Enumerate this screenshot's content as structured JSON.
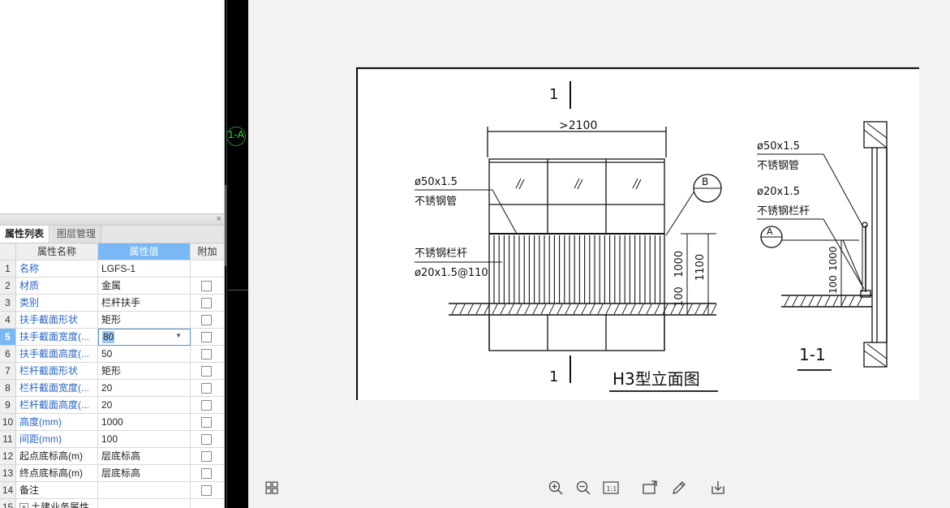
{
  "panel": {
    "close_glyph": "×",
    "tabs": [
      "属性列表",
      "图层管理"
    ],
    "columns": [
      "属性名称",
      "属性值",
      "附加"
    ],
    "rows": [
      {
        "num": "1",
        "name": "名称",
        "value": "LGFS-1",
        "blue": true,
        "checkbox": false
      },
      {
        "num": "2",
        "name": "材质",
        "value": "金属",
        "blue": true,
        "checkbox": true
      },
      {
        "num": "3",
        "name": "类别",
        "value": "栏杆扶手",
        "blue": true,
        "checkbox": true
      },
      {
        "num": "4",
        "name": "扶手截面形状",
        "value": "矩形",
        "blue": true,
        "checkbox": true
      },
      {
        "num": "5",
        "name": "扶手截面宽度(...",
        "value": "80",
        "blue": true,
        "checkbox": true,
        "editing": true
      },
      {
        "num": "6",
        "name": "扶手截面高度(...",
        "value": "50",
        "blue": true,
        "checkbox": true
      },
      {
        "num": "7",
        "name": "栏杆截面形状",
        "value": "矩形",
        "blue": true,
        "checkbox": true
      },
      {
        "num": "8",
        "name": "栏杆截面宽度(...",
        "value": "20",
        "blue": true,
        "checkbox": true
      },
      {
        "num": "9",
        "name": "栏杆截面高度(...",
        "value": "20",
        "blue": true,
        "checkbox": true
      },
      {
        "num": "10",
        "name": "高度(mm)",
        "value": "1000",
        "blue": true,
        "checkbox": true
      },
      {
        "num": "11",
        "name": "间距(mm)",
        "value": "100",
        "blue": true,
        "checkbox": true
      },
      {
        "num": "12",
        "name": "起点底标高(m)",
        "value": "层底标高",
        "blue": false,
        "checkbox": true
      },
      {
        "num": "13",
        "name": "终点底标高(m)",
        "value": "层底标高",
        "blue": false,
        "checkbox": true
      },
      {
        "num": "14",
        "name": "备注",
        "value": "",
        "blue": false,
        "checkbox": true
      },
      {
        "num": "15",
        "name": "土建业务属性",
        "value": "",
        "blue": false,
        "checkbox": false,
        "expander": "+"
      }
    ]
  },
  "cad": {
    "label": "1-A"
  },
  "drawing": {
    "section_mark": "1",
    "dim_width": ">2100",
    "handrail_spec": "ø50x1.5",
    "handrail_name": "不锈钢管",
    "baluster_name": "不锈钢栏杆",
    "baluster_spec": "ø20x1.5@110",
    "dim_1000": "1000",
    "dim_1100": "1100",
    "dim_100": "100",
    "callout_b": "B",
    "callout_a": "A",
    "title": "H3型立面图",
    "section_title": "1-1",
    "right_handrail_spec": "ø50x1.5",
    "right_handrail_name": "不锈钢管",
    "right_baluster_spec": "ø20x1.5",
    "right_baluster_name": "不锈钢栏杆",
    "right_dim_1000": "1000",
    "right_dim_100": "100"
  },
  "toolbar": {
    "icons": [
      "grid-icon",
      "zoom-in-icon",
      "zoom-out-icon",
      "actual-size-icon",
      "rotate-icon",
      "pen-icon",
      "download-icon"
    ],
    "actual_size_label": "1:1"
  }
}
